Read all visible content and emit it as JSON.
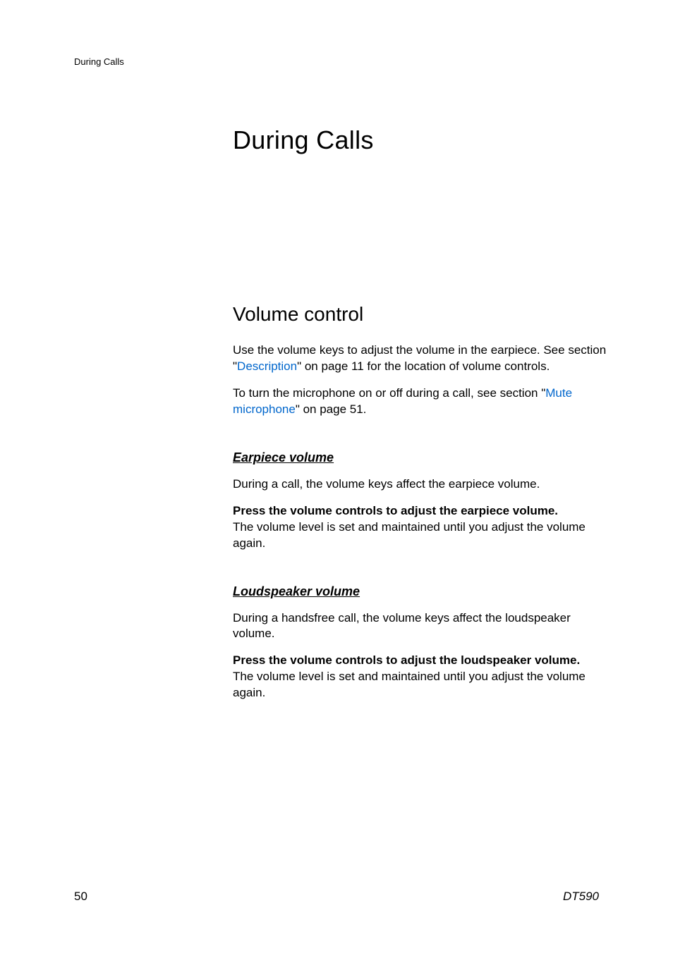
{
  "header": {
    "section_name": "During Calls"
  },
  "chapter": {
    "title": "During Calls"
  },
  "section": {
    "title": "Volume control",
    "intro_before": "Use the volume keys to adjust the volume in the earpiece. See section \"",
    "intro_link": "Description",
    "intro_after": "\" on page 11 for the location of volume controls.",
    "mute_before": "To turn the microphone on or off during a call, see section \"",
    "mute_link": "Mute microphone",
    "mute_after": "\" on page 51."
  },
  "earpiece": {
    "title": "Earpiece volume",
    "text1": "During a call, the volume keys affect the earpiece volume.",
    "bold": "Press the volume controls to adjust the earpiece volume.",
    "text2": "The volume level is set and maintained until you adjust the volume again."
  },
  "loudspeaker": {
    "title": "Loudspeaker volume",
    "text1": "During a handsfree call, the volume keys affect the loudspeaker volume.",
    "bold": "Press the volume controls to adjust the loudspeaker volume.",
    "text2": "The volume level is set and maintained until you adjust the volume again."
  },
  "footer": {
    "page": "50",
    "doc_id": "DT590"
  }
}
